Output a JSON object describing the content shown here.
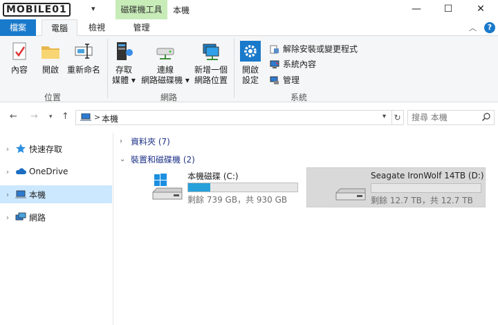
{
  "watermark": {
    "text": "MOBILE01"
  },
  "titlebar": {
    "context_tab": "磁碟機工具",
    "window_title": "本機",
    "minimize": "—",
    "maximize": "☐",
    "close": "✕"
  },
  "tabs": {
    "file": "檔案",
    "computer": "電腦",
    "view": "檢視",
    "manage": "管理"
  },
  "ribbon": {
    "location": {
      "properties": "內容",
      "open": "開啟",
      "rename": "重新命名",
      "label": "位置"
    },
    "network": {
      "access_media": [
        "存取",
        "媒體 ▾"
      ],
      "map_drive": [
        "連線",
        "網路磁碟機 ▾"
      ],
      "add_location": [
        "新增一個",
        "網路位置"
      ],
      "label": "網路"
    },
    "system": {
      "open_settings": [
        "開啟",
        "設定"
      ],
      "uninstall": "解除安裝或變更程式",
      "system_properties": "系統內容",
      "manage": "管理",
      "label": "系統"
    }
  },
  "address": {
    "crumb_sep": ">",
    "crumb": "本機",
    "search_placeholder": "搜尋 本機"
  },
  "nav": {
    "quick_access": "快速存取",
    "onedrive": "OneDrive",
    "this_pc": "本機",
    "network": "網路"
  },
  "content": {
    "folders_group": "資料夾 (7)",
    "devices_group": "裝置和磁碟機 (2)",
    "drives": [
      {
        "name": "本機磁碟 (C:)",
        "info": "剩餘 739 GB，共 930 GB",
        "used_fraction": 0.205
      },
      {
        "name": "Seagate IronWolf 14TB (D:)",
        "info": "剩餘 12.7 TB，共 12.7 TB",
        "used_fraction": 0.0
      }
    ]
  },
  "colors": {
    "accent": "#1979ca",
    "context_tab_bg": "#c7ecb8",
    "selection": "#cce8ff",
    "capacity_bar": "#26a0da"
  }
}
